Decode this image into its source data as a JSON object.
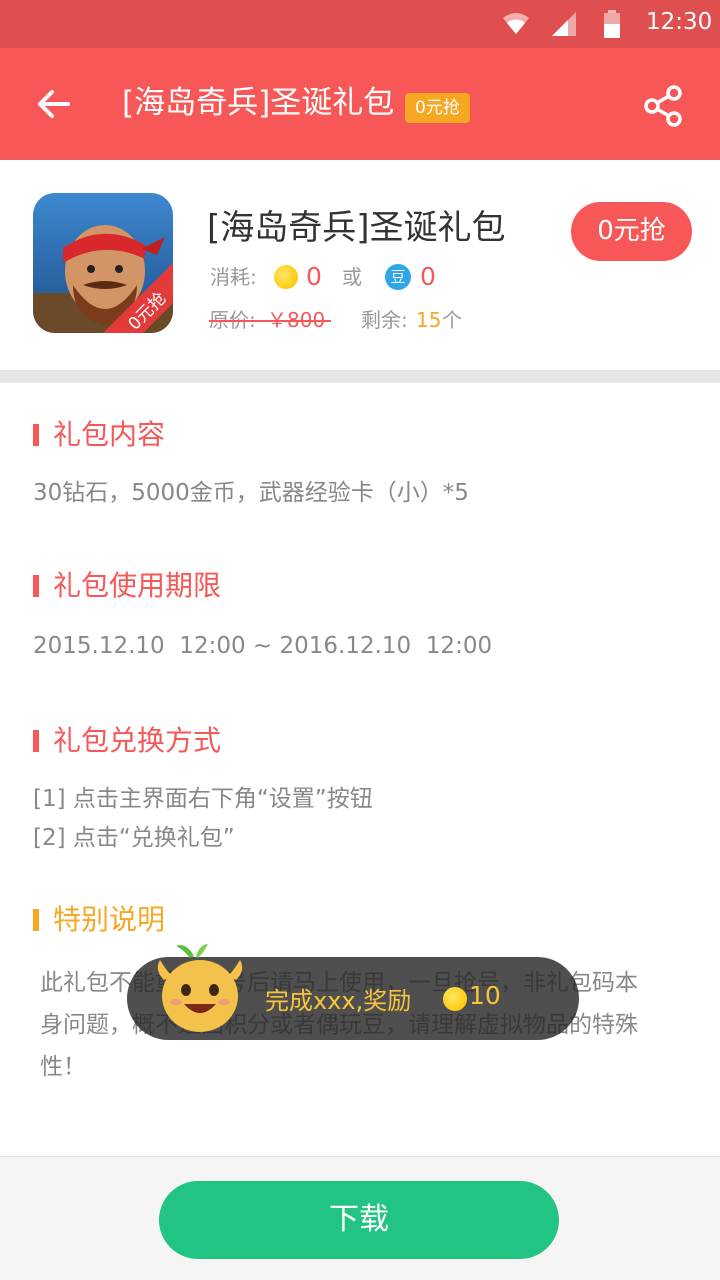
{
  "status_bar": {
    "time": "12:30"
  },
  "header": {
    "title": "[海岛奇兵]圣诞礼包",
    "tag": "0元抢"
  },
  "gift": {
    "name": "[海岛奇兵]圣诞礼包",
    "icon_ribbon": "0元抢",
    "grab_button": "0元抢",
    "cost_label": "消耗:",
    "coin_cost": "0",
    "or_label": "或",
    "bean_icon_char": "豆",
    "bean_cost": "0",
    "original_price_label": "原价:",
    "original_price": "￥800",
    "remaining_label": "剩余:",
    "remaining_count": "15",
    "remaining_unit": "个"
  },
  "sections": {
    "content": {
      "title": "礼包内容",
      "text": "30钻石，5000金币，武器经验卡（小）*5"
    },
    "period": {
      "title": "礼包使用期限",
      "text": "2015.12.10  12:00 ~ 2016.12.10  12:00"
    },
    "redeem": {
      "title": "礼包兑换方式",
      "step1": "[1] 点击主界面右下角“设置”按钮",
      "step2": "[2] 点击“兑换礼包”"
    },
    "notice": {
      "title": "特别说明",
      "text": "此礼包不能重复抢号后请马上使用，一旦抢号，非礼包码本身问题，概不退回积分或者偶玩豆，请理解虚拟物品的特殊性！"
    }
  },
  "toast": {
    "text": "完成xxx,奖励",
    "amount": "10"
  },
  "bottom": {
    "download_label": "下载"
  },
  "colors": {
    "primary": "#f85757",
    "accent": "#f7a823",
    "download": "#22c483",
    "bean": "#2ea6e8"
  },
  "icons": [
    "wifi-icon",
    "signal-icon",
    "battery-icon",
    "back-arrow-icon",
    "share-icon",
    "coin-icon",
    "bean-icon",
    "mascot-icon"
  ]
}
